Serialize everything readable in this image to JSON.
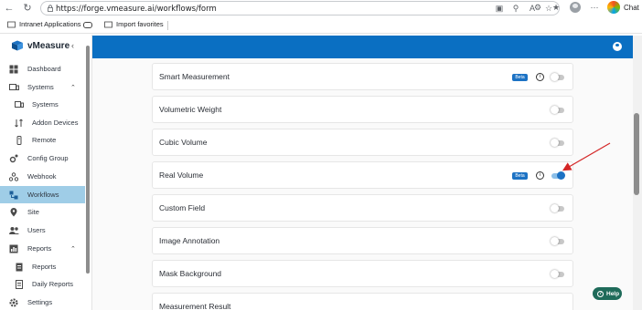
{
  "browser": {
    "url": "https://forge.vmeasure.ai/workflows/form",
    "chat_label": "Chat",
    "bookmarks": [
      "Intranet Applications",
      "Import favorites"
    ]
  },
  "sidebar": {
    "brand": "vMeasure",
    "items": [
      {
        "label": "Dashboard",
        "icon": "dashboard-icon"
      },
      {
        "label": "Systems",
        "icon": "systems-icon",
        "expanded": true
      },
      {
        "label": "Systems",
        "icon": "system-device-icon"
      },
      {
        "label": "Addon Devices",
        "icon": "addon-devices-icon"
      },
      {
        "label": "Remote",
        "icon": "remote-icon"
      },
      {
        "label": "Config Group",
        "icon": "config-group-icon"
      },
      {
        "label": "Webhook",
        "icon": "webhook-icon"
      },
      {
        "label": "Workflows",
        "icon": "workflows-icon",
        "active": true
      },
      {
        "label": "Site",
        "icon": "site-icon"
      },
      {
        "label": "Users",
        "icon": "users-icon"
      },
      {
        "label": "Reports",
        "icon": "reports-icon",
        "expanded": true
      },
      {
        "label": "Reports",
        "icon": "report-doc-icon"
      },
      {
        "label": "Daily Reports",
        "icon": "daily-reports-icon"
      },
      {
        "label": "Settings",
        "icon": "settings-icon"
      }
    ]
  },
  "workflow": {
    "rows": [
      {
        "label": "Smart Measurement",
        "beta": "Beta",
        "has_info": true,
        "enabled": false
      },
      {
        "label": "Volumetric Weight",
        "has_info": false,
        "enabled": false
      },
      {
        "label": "Cubic Volume",
        "has_info": false,
        "enabled": false
      },
      {
        "label": "Real Volume",
        "beta": "Beta",
        "has_info": true,
        "enabled": true
      },
      {
        "label": "Custom Field",
        "has_info": false,
        "enabled": false
      },
      {
        "label": "Image Annotation",
        "has_info": false,
        "enabled": false
      },
      {
        "label": "Mask Background",
        "has_info": false,
        "enabled": false
      },
      {
        "label": "Measurement Result",
        "has_info": false,
        "enabled": false
      }
    ]
  },
  "help": {
    "label": "Help"
  },
  "colors": {
    "header": "#0a6fc2",
    "active_nav": "#9fcde7",
    "beta": "#1c72c4",
    "toggle_on": "#1d72c4",
    "annotation_arrow": "#d42626"
  }
}
